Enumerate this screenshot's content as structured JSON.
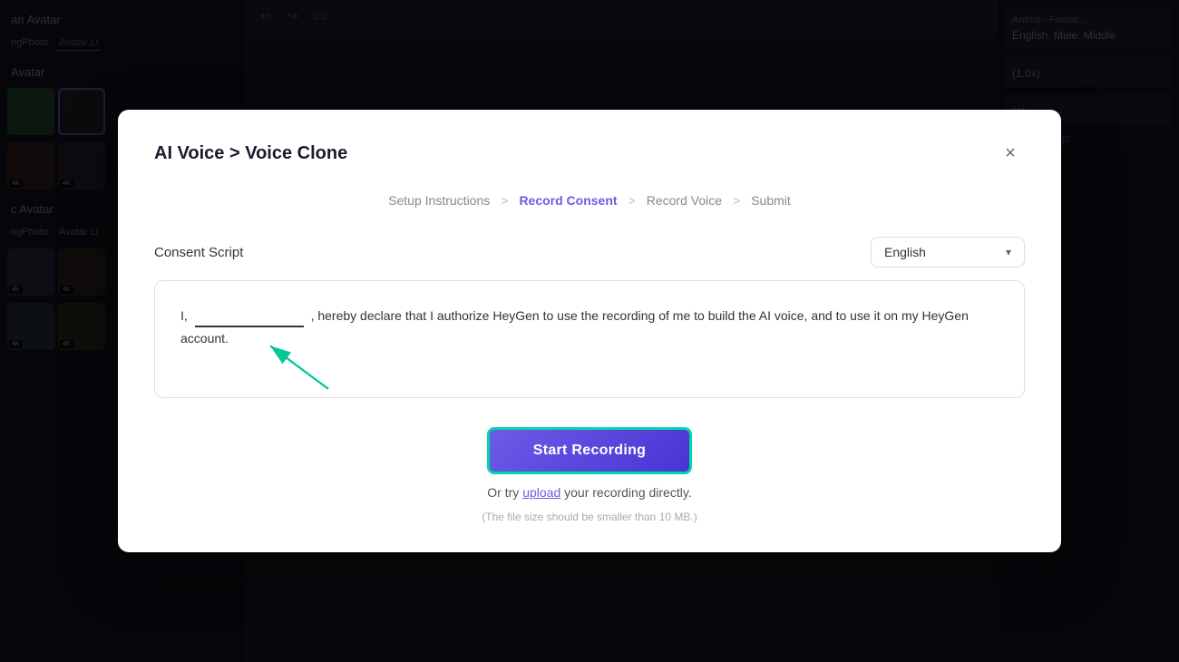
{
  "modal": {
    "title": "AI Voice > Voice Clone",
    "close_label": "×"
  },
  "steps": [
    {
      "label": "Setup Instructions",
      "active": false
    },
    {
      "separator": ">"
    },
    {
      "label": "Record Consent",
      "active": true
    },
    {
      "separator": ">"
    },
    {
      "label": "Record Voice",
      "active": false
    },
    {
      "separator": ">"
    },
    {
      "label": "Submit",
      "active": false
    }
  ],
  "consent": {
    "section_label": "Consent Script",
    "language": "English",
    "language_chevron": "▾",
    "script_text_prefix": "I,",
    "script_text_suffix": ", hereby declare that I authorize HeyGen to use the recording of me to build the AI voice, and to use it on my HeyGen account."
  },
  "actions": {
    "start_recording_label": "Start Recording",
    "upload_text_before": "Or try ",
    "upload_link": "upload",
    "upload_text_after": " your recording directly.",
    "upload_note": "(The file size should be smaller than 10 MB.)"
  },
  "background": {
    "title": "an Avatar",
    "subtitle": "Avatar",
    "tabs": [
      "ngPhoto",
      "Avatar Li"
    ]
  }
}
